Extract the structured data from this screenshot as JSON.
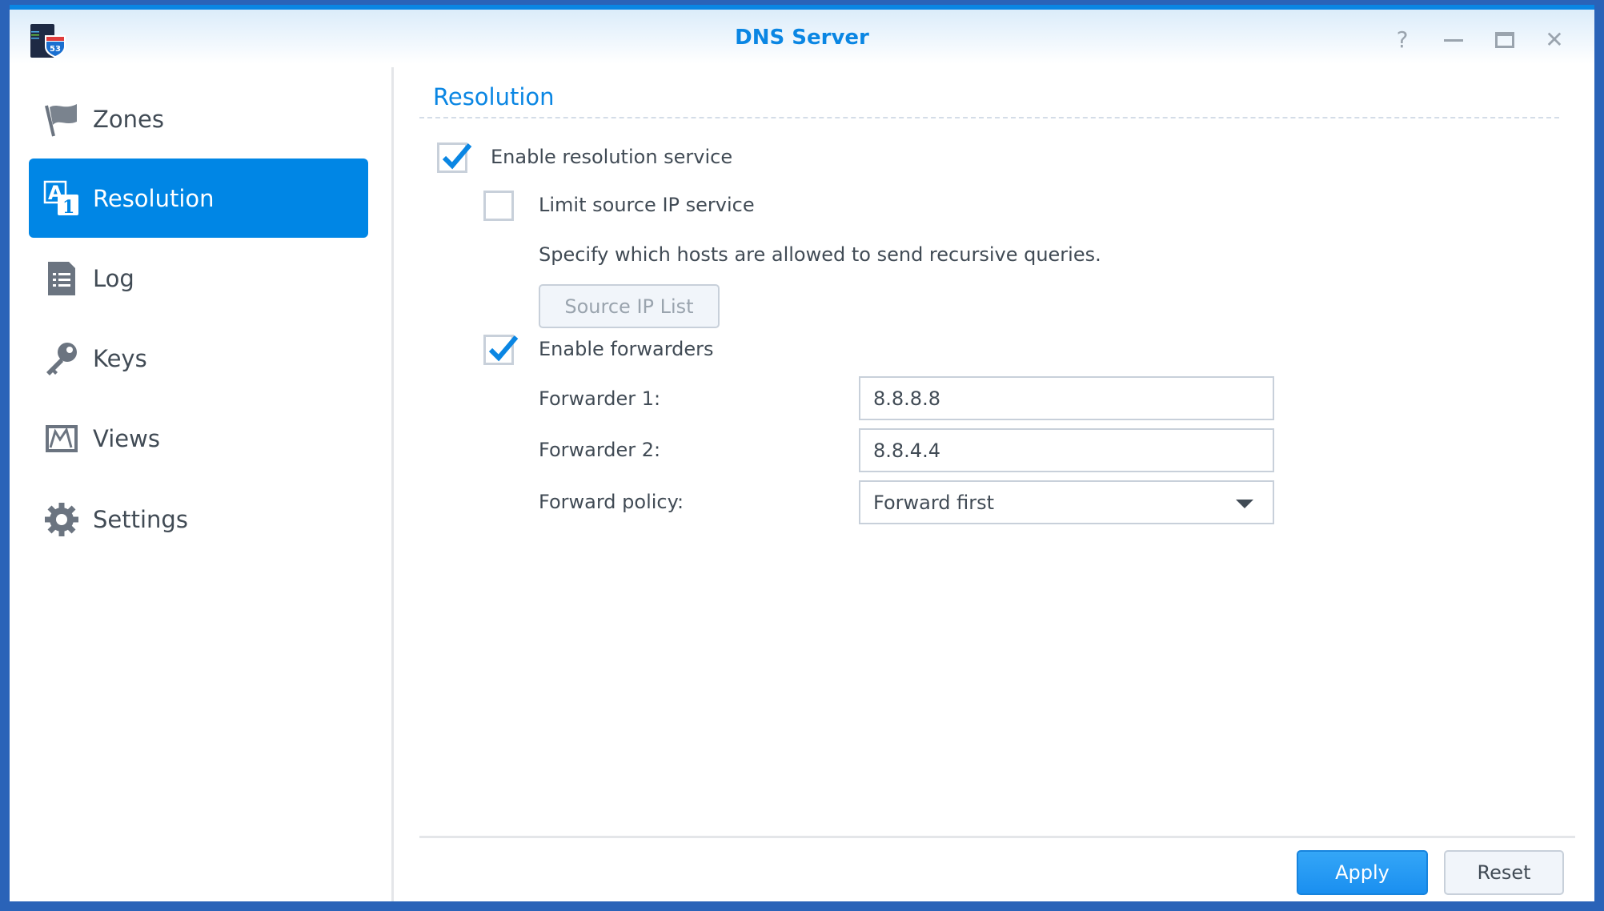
{
  "window": {
    "title": "DNS Server",
    "app_icon_badge": "53"
  },
  "sidebar": {
    "items": [
      {
        "label": "Zones",
        "icon": "flag-icon"
      },
      {
        "label": "Resolution",
        "icon": "resolution-icon",
        "active": true
      },
      {
        "label": "Log",
        "icon": "log-icon"
      },
      {
        "label": "Keys",
        "icon": "key-icon"
      },
      {
        "label": "Views",
        "icon": "views-icon"
      },
      {
        "label": "Settings",
        "icon": "gear-icon"
      }
    ]
  },
  "main": {
    "heading": "Resolution",
    "enable_resolution": {
      "label": "Enable resolution service",
      "checked": true
    },
    "limit_source": {
      "label": "Limit source IP service",
      "checked": false
    },
    "description": "Specify which hosts are allowed to send recursive queries.",
    "source_ip_button": "Source IP List",
    "enable_forwarders": {
      "label": "Enable forwarders",
      "checked": true
    },
    "forwarder1": {
      "label": "Forwarder 1:",
      "value": "8.8.8.8"
    },
    "forwarder2": {
      "label": "Forwarder 2:",
      "value": "8.8.4.4"
    },
    "policy": {
      "label": "Forward policy:",
      "value": "Forward first"
    }
  },
  "footer": {
    "apply": "Apply",
    "reset": "Reset"
  },
  "colors": {
    "accent": "#0086e5"
  }
}
